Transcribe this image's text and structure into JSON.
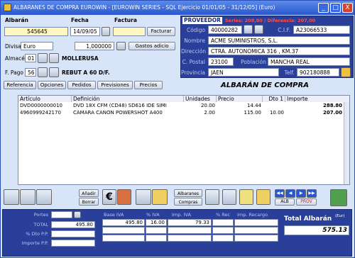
{
  "window": {
    "title": "ALBARANES DE COMPRA EUROWIN - [EUROWIN SERIES - SQL Ejercicio 01/01/05 - 31/12/05] (Euro)",
    "min": "_",
    "max": "□",
    "close": "X"
  },
  "header": {
    "albaran_label": "Albarán",
    "fecha_label": "Fecha",
    "factura_label": "Factura",
    "albaran_value": "545645",
    "fecha_value": "14/09/05",
    "factura_value": "",
    "facturar_btn": "Facturar",
    "divisa_label": "Divisa",
    "divisa_value": "Euro",
    "cambio_value": "1,000000",
    "gastos_btn": "Gastos adicio",
    "almacen_label": "Almacén",
    "almacen_code": "01",
    "almacen_name": "MOLLERUSA",
    "fpago_label": "F. Pago",
    "fpago_code": "56",
    "fpago_name": "REBUT A 60 D/F."
  },
  "tabs": [
    "Referencia",
    "Opciones",
    "Pedidos",
    "Previsiones",
    "Precios"
  ],
  "proveedor": {
    "title": "PROVEEDOR",
    "series_info": "Series: 208,80 / Diferencia: 207,00",
    "codigo_label": "Código",
    "codigo_value": "40000282",
    "cif_label": "C.I.F.",
    "cif_value": "A23066533",
    "nombre_label": "Nombre",
    "nombre_value": "ACME SUMINISTROS, S.L.",
    "direccion_label": "Dirección",
    "direccion_value": "CTRA. AUTONOMICA 316 , KM.37",
    "cpostal_label": "C. Postal",
    "cpostal_value": "23100",
    "poblacion_label": "Población",
    "poblacion_value": "MANCHA REAL",
    "provincia_label": "Provincia",
    "provincia_value": "JAEN",
    "telf_label": "Telf.",
    "telf_value": "902180888"
  },
  "doc_title": "ALBARÁN DE COMPRA",
  "grid": {
    "headers": [
      "Artículo",
      "Definición",
      "Unidades",
      "Precio",
      "Dto 1",
      "Importe"
    ],
    "rows": [
      {
        "articulo": "DVD0000000010",
        "definicion": "DVD 18X CFM (CD48) SD616 IDE SIMI",
        "unidades": "20.00",
        "precio": "14.44",
        "dto": "",
        "importe": "288.80"
      },
      {
        "articulo": "4960999242170",
        "definicion": "CAMARA CANON POWERSHOT A400",
        "unidades": "2.00",
        "precio": "115.00",
        "dto": "10.00",
        "importe": "207.00"
      }
    ]
  },
  "toolbar": {
    "anadir_btn": "Añadir",
    "borrar_btn": "Borrar",
    "albaranes_btn": "Albaranes",
    "compras_btn": "Compras",
    "alb_btn": "ALB",
    "prov_btn": "PROV",
    "euro": "€"
  },
  "totals": {
    "portes_label": "Portes",
    "total_label": "TOTAL",
    "dto_pp_label": "% Dto P.P.",
    "importe_pp_label": "Importe P.P.",
    "portes_value": "",
    "total_value": "495.80",
    "dto_pp_value": "",
    "importe_pp_value": "",
    "base_iva_label": "Base IVA",
    "pct_iva_label": "% IVA",
    "imp_iva_label": "Imp. IVA",
    "pct_rec_label": "% Rec",
    "imp_rec_label": "Imp. Recargo",
    "base_iva_value": "495.80",
    "pct_iva_value": "16.00",
    "imp_iva_value": "79.33",
    "total_albaran_label": "Total Albarán",
    "currency_tag": "(Eur)",
    "total_albaran_value": "575.13"
  }
}
